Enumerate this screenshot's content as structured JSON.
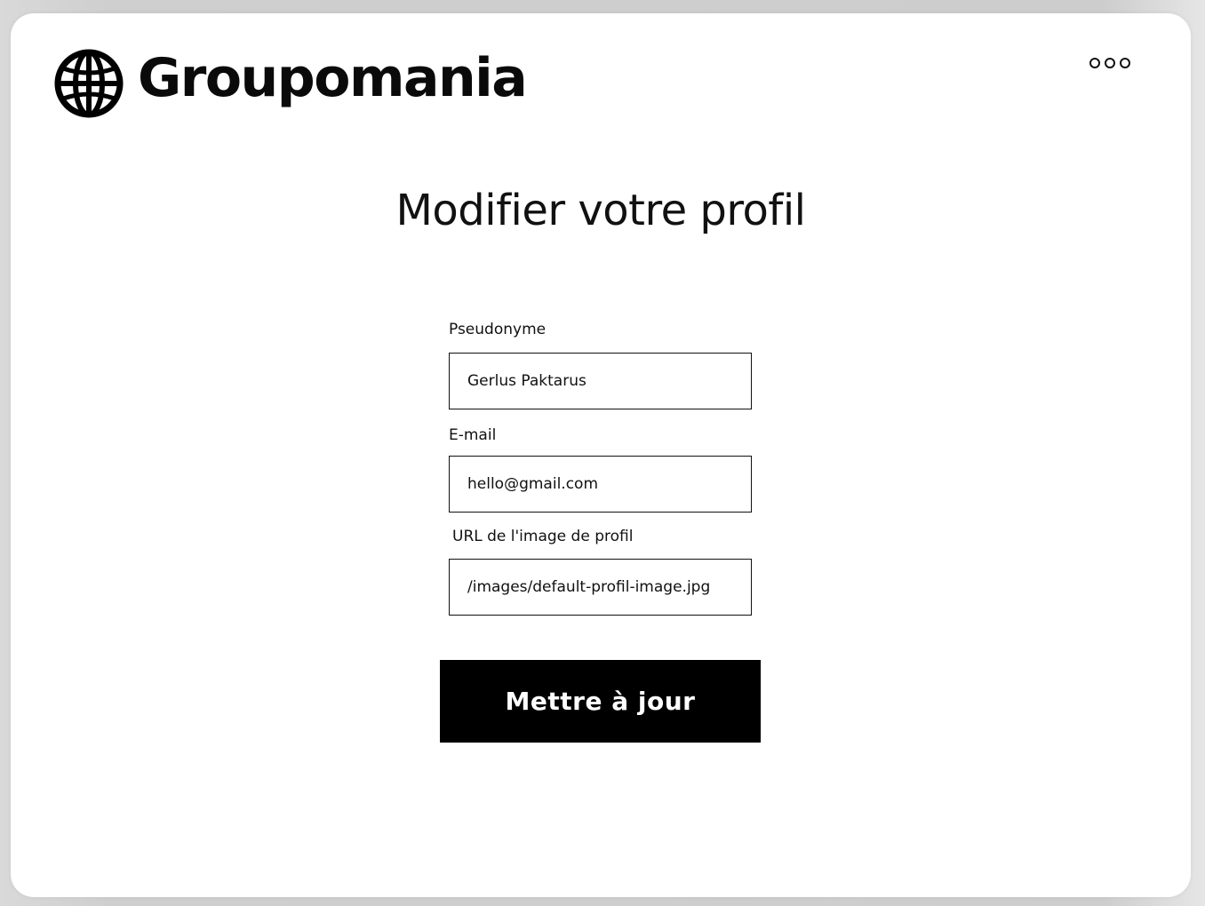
{
  "header": {
    "brand_name": "Groupomania",
    "logo_icon": "globe-icon",
    "menu_icon": "more-options-icon"
  },
  "main": {
    "title": "Modifier votre profil",
    "form": {
      "pseudonym": {
        "label": "Pseudonyme",
        "value": "Gerlus Paktarus"
      },
      "email": {
        "label": "E-mail",
        "value": "hello@gmail.com"
      },
      "image_url": {
        "label": "URL de l'image de profil",
        "value": "/images/default-profil-image.jpg"
      },
      "submit_label": "Mettre à jour"
    }
  },
  "colors": {
    "background": "#d0d0d0",
    "card": "#ffffff",
    "text": "#111111",
    "button": "#000000",
    "button_text": "#ffffff"
  }
}
